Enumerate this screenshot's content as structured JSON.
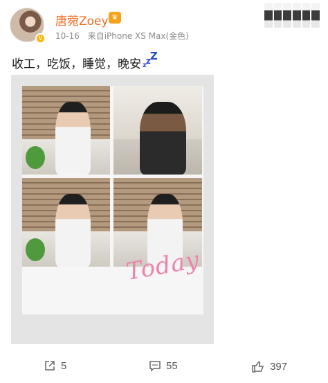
{
  "post": {
    "author": {
      "name": "唐菀Zoey",
      "badge_icon": "vip-crown-icon",
      "verified_icon": "verified-v-icon"
    },
    "time": "10-16",
    "source": "来自iPhone XS Max(金色)",
    "text": "收工，吃饭，睡觉，晚安",
    "sleep_emoji": [
      "z",
      "z",
      "Z"
    ],
    "image": {
      "handwriting": "Today"
    },
    "actions": {
      "repost": {
        "icon": "repost-icon",
        "count": "5"
      },
      "comment": {
        "icon": "comment-icon",
        "count": "55"
      },
      "like": {
        "icon": "thumbs-up-icon",
        "count": "397"
      }
    }
  },
  "colors": {
    "username": "#f36b21",
    "meta": "#8a8a8a",
    "handwriting": "#ea83ad",
    "emoji_blue": "#2a4cc8"
  }
}
